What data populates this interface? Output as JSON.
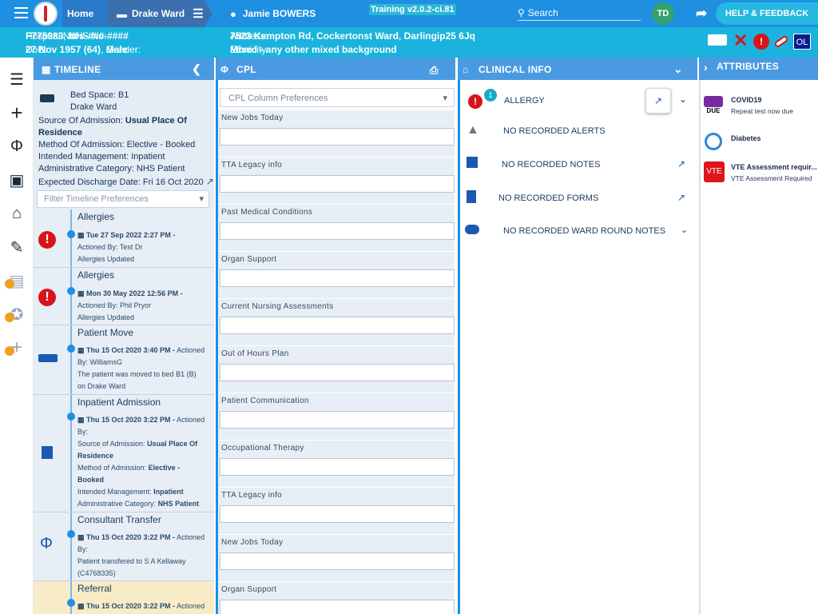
{
  "topbar": {
    "home_label": "Home",
    "ward_label": "Drake Ward",
    "patient_name": "Jamie BOWERS",
    "version": "Training v2.0.2-ci.81",
    "search_placeholder": "Search",
    "user_initials": "TD",
    "help_label": "HELP & FEEDBACK",
    "colors": {
      "primary": "#1e8fe1",
      "banner": "#1bb3dd",
      "alert": "#d7141a"
    }
  },
  "patient": {
    "hospital_no_label": "Hospital No:",
    "hospital_no": "F775983",
    "nhs_no_label": "NHS No:",
    "nhs_no": "###-###-####",
    "dob_label": "DoB:",
    "dob": "27 Nov 1957 (64)",
    "gender_label": "Gender:",
    "gender": "Male",
    "address_label": "Address:",
    "address": "7523 Kempton Rd, Cockertonst Ward, Darlingip25 6Jq",
    "ethnicity_label": "Ethnicity:",
    "ethnicity": "Mixed - any other mixed background",
    "badge_ol": "OL"
  },
  "timeline": {
    "header": "TIMELINE",
    "bed_space": "Bed Space: B1",
    "ward": "Drake Ward",
    "source_label": "Source Of Admission:",
    "source_value": "Usual Place Of",
    "source_value2": "Residence",
    "method": "Method Of Admission: Elective - Booked",
    "intended": "Intended Management: Inpatient",
    "admin_cat": "Administrative Category: NHS Patient",
    "discharge": "Expected Discharge Date: Fri 16 Oct 2020",
    "filter_placeholder": "Filter Timeline Preferences",
    "events": [
      {
        "title": "Allergies",
        "date": "Tue 27 Sep 2022 2:27 PM -",
        "l2": "Actioned By: Test Dr",
        "l3": "Allergies Updated"
      },
      {
        "title": "Allergies",
        "date": "Mon 30 May 2022 12:56 PM -",
        "l2": "Actioned By: Phil Pryor",
        "l3": "Allergies Updated"
      },
      {
        "title": "Patient Move",
        "date": "Thu 15 Oct 2020 3:40 PM -",
        "date_suffix": "Actioned",
        "l2": "By: WilliamsG",
        "l3": "The patient was moved to bed B1 (B)",
        "l4": "on Drake Ward"
      },
      {
        "title": "Inpatient Admission",
        "date": "Thu 15 Oct 2020 3:22 PM -",
        "date_suffix": "Actioned",
        "l2": "By:",
        "l3a": "Source of Admission:",
        "l3b": "Usual Place Of",
        "l4": "Residence",
        "l5a": "Method of Admission:",
        "l5b": "Elective -",
        "l6": "Booked",
        "l7a": "Intended Management:",
        "l7b": "Inpatient",
        "l8a": "Administrative Category:",
        "l8b": "NHS Patient"
      },
      {
        "title": "Consultant Transfer",
        "date": "Thu 15 Oct 2020 3:22 PM -",
        "date_suffix": "Actioned",
        "l2": "By:",
        "l3": "Patient transfered to S A Kellaway",
        "l4": "(C4768335)"
      },
      {
        "title": "Referral",
        "date": "Thu 15 Oct 2020 3:22 PM -",
        "date_suffix": "Actioned"
      }
    ]
  },
  "cpl": {
    "header": "CPL",
    "select_placeholder": "CPL Column Preferences",
    "sections": [
      "New Jobs Today",
      "TTA Legacy info",
      "Past Medical Conditions",
      "Organ Support",
      "Current Nursing Assessments",
      "Out of Hours Plan",
      "Patient Communication",
      "Occupational Therapy",
      "TTA Legacy info",
      "New Jobs Today",
      "Organ Support"
    ]
  },
  "clinical": {
    "header": "CLINICAL INFO",
    "allergy_count": "1",
    "allergy": "ALLERGY",
    "alerts": "NO RECORDED ALERTS",
    "notes": "NO RECORDED NOTES",
    "forms": "NO RECORDED FORMS",
    "ward_round": "NO RECORDED WARD ROUND NOTES"
  },
  "attributes": {
    "header": "ATTRIBUTES",
    "items": [
      {
        "title": "COVID19",
        "sub": "Repeat test now due",
        "badge": "DUE"
      },
      {
        "title": "Diabetes",
        "sub": ""
      },
      {
        "title": "VTE Assessment requir...",
        "sub": "VTE Assessment Required",
        "badge": "VTE"
      }
    ]
  }
}
